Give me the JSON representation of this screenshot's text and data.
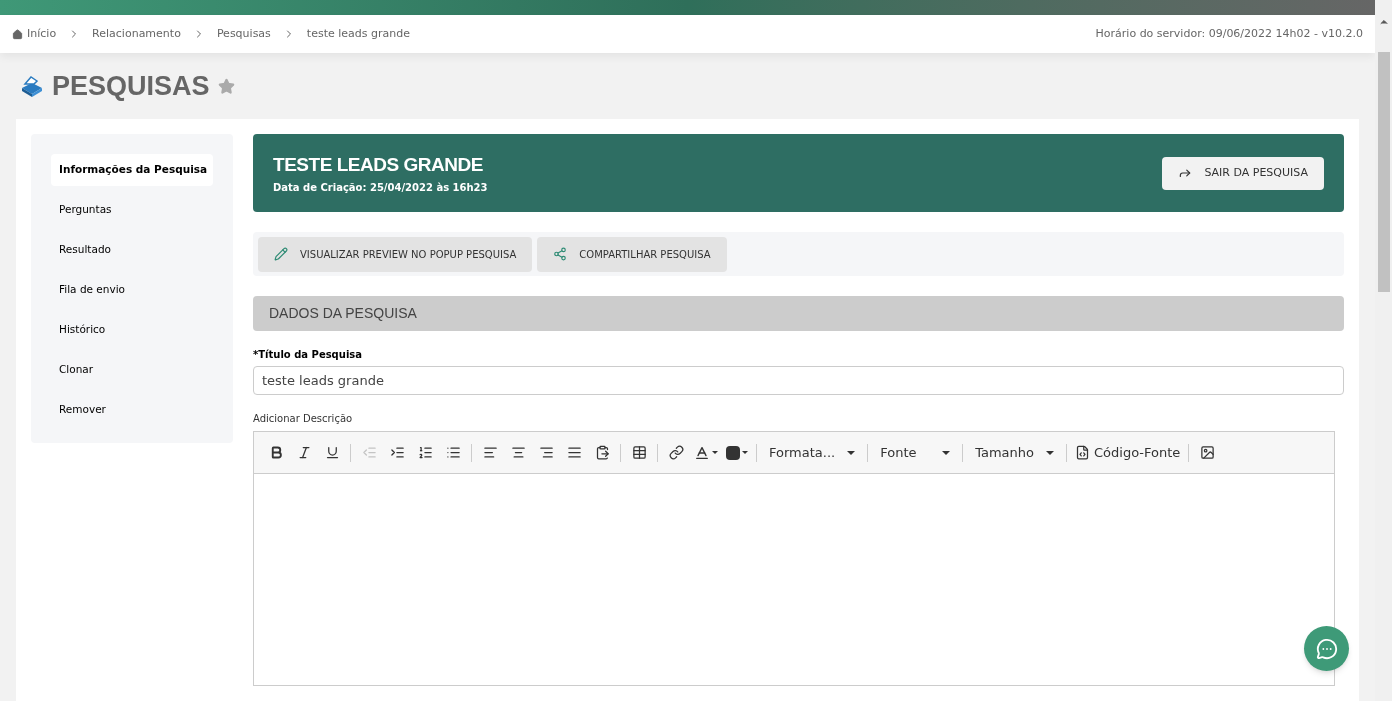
{
  "breadcrumb": [
    "Início",
    "Relacionamento",
    "Pesquisas",
    "teste leads grande"
  ],
  "server_info": "Horário do servidor: 09/06/2022 14h02 - v10.2.0",
  "page_title": "PESQUISAS",
  "favorite": false,
  "sidebar": {
    "items": [
      {
        "label": "Informações da Pesquisa",
        "selected": true
      },
      {
        "label": "Perguntas",
        "selected": false
      },
      {
        "label": "Resultado",
        "selected": false
      },
      {
        "label": "Fila de envio",
        "selected": false
      },
      {
        "label": "Histórico",
        "selected": false
      },
      {
        "label": "Clonar",
        "selected": false
      },
      {
        "label": "Remover",
        "selected": false
      }
    ]
  },
  "header": {
    "title": "TESTE LEADS GRANDE",
    "subtitle": "Data de Criação: 25/04/2022 às 16h23",
    "exit_button": "SAIR DA PESQUISA"
  },
  "actions": [
    {
      "kind": "edit",
      "label": "VISUALIZAR PREVIEW NO POPUP PESQUISA"
    },
    {
      "kind": "share",
      "label": "COMPARTILHAR PESQUISA"
    }
  ],
  "section_title": "DADOS DA PESQUISA",
  "title_field": {
    "label": "Título da Pesquisa",
    "required_mark": "*",
    "value": "teste leads grande"
  },
  "description_label": "Adicionar Descrição",
  "toolbar": [
    [
      {
        "kind": "bold",
        "disabled": false
      },
      {
        "kind": "italic",
        "disabled": false
      },
      {
        "kind": "underline",
        "disabled": false
      }
    ],
    [
      {
        "kind": "outdent",
        "disabled": true
      },
      {
        "kind": "indent",
        "disabled": false
      },
      {
        "kind": "ordered",
        "disabled": false
      },
      {
        "kind": "bullets",
        "disabled": false
      }
    ],
    [
      {
        "kind": "left",
        "disabled": false
      },
      {
        "kind": "center",
        "disabled": false
      },
      {
        "kind": "right",
        "disabled": false
      },
      {
        "kind": "justify",
        "disabled": false
      },
      {
        "kind": "paste",
        "disabled": false
      }
    ],
    [
      {
        "kind": "table",
        "disabled": false
      }
    ],
    [
      {
        "kind": "link",
        "disabled": false
      },
      {
        "kind": "textcolor",
        "disabled": false
      },
      {
        "kind": "bgcolor",
        "disabled": false
      }
    ],
    [
      {
        "kind": "dropdown",
        "label": "Formata..."
      }
    ],
    [
      {
        "kind": "dropdown",
        "label": "Fonte"
      }
    ],
    [
      {
        "kind": "dropdown",
        "label": "Tamanho"
      }
    ],
    [
      {
        "kind": "source",
        "label": "Código-Fonte"
      }
    ],
    [
      {
        "kind": "image",
        "disabled": false
      }
    ]
  ]
}
